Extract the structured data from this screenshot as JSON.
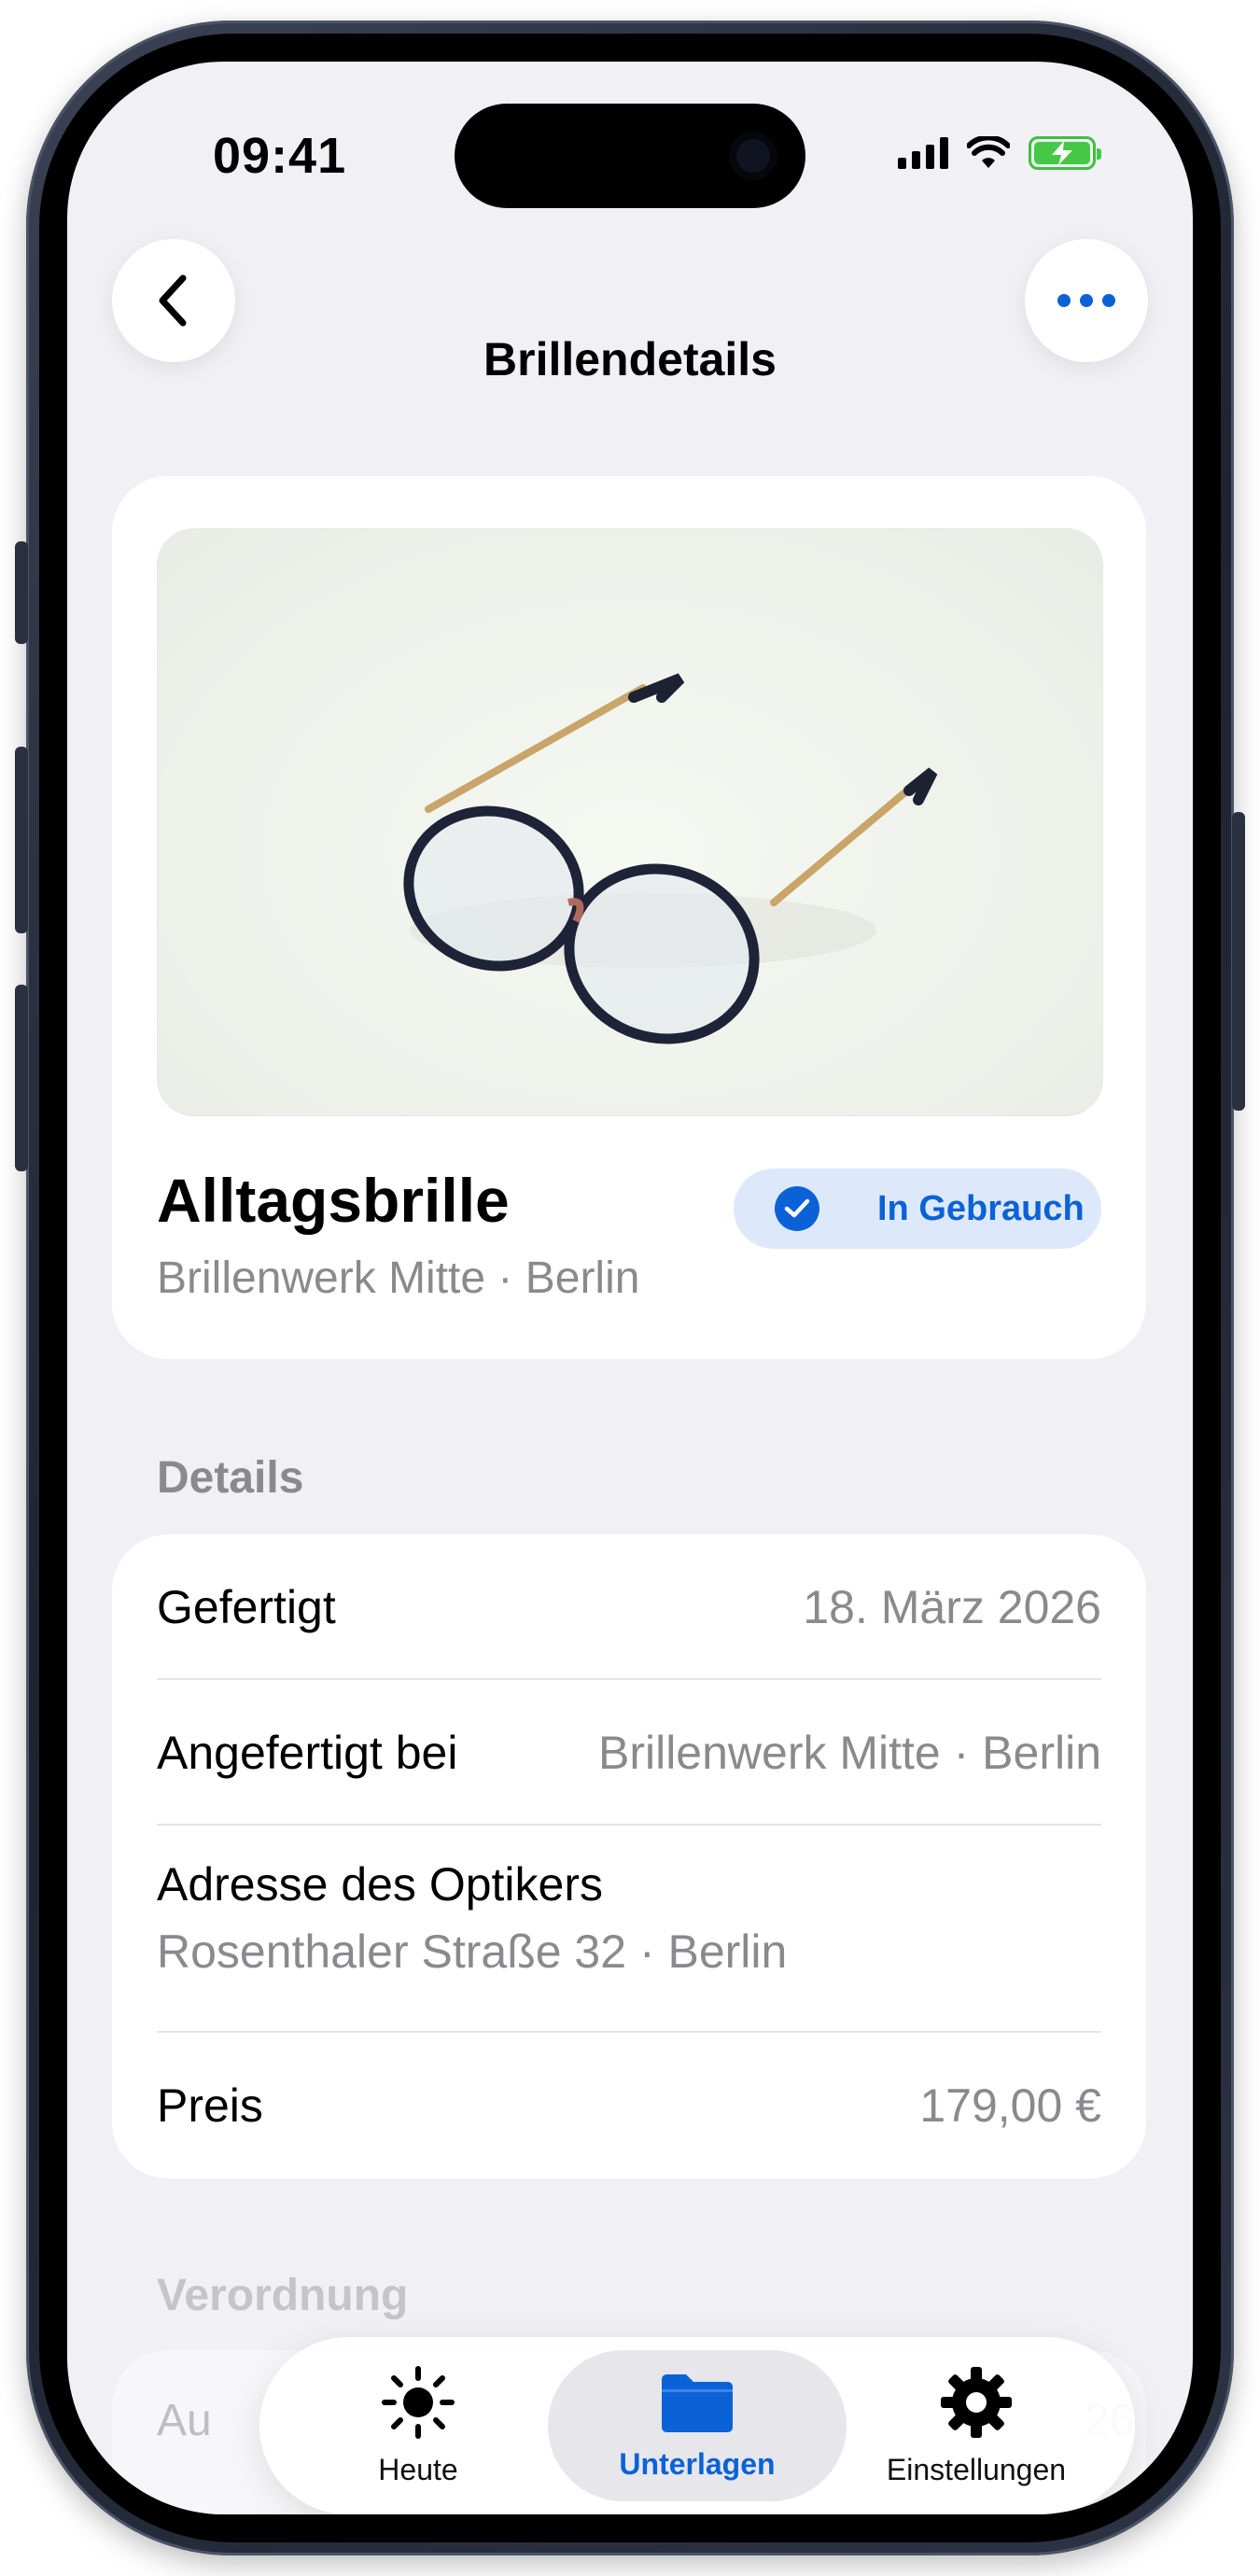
{
  "status_bar": {
    "time": "09:41"
  },
  "header": {
    "title": "Brillendetails"
  },
  "glasses": {
    "name": "Alltagsbrille",
    "subtitle": "Brillenwerk Mitte · Berlin",
    "status": "In Gebrauch"
  },
  "details": {
    "section_title": "Details",
    "rows": [
      {
        "label": "Gefertigt",
        "value": "18. März 2026"
      },
      {
        "label": "Angefertigt bei",
        "value": "Brillenwerk Mitte · Berlin"
      },
      {
        "label": "Adresse des Optikers",
        "value": "Rosenthaler Straße 32 · Berlin"
      },
      {
        "label": "Preis",
        "value": "179,00 €"
      }
    ]
  },
  "next_section": {
    "title": "Verordnung",
    "row_label": "Au",
    "row_value": "26"
  },
  "tabbar": {
    "items": [
      {
        "label": "Heute",
        "icon": "sun-icon"
      },
      {
        "label": "Unterlagen",
        "icon": "folder-icon",
        "active": true
      },
      {
        "label": "Einstellungen",
        "icon": "gear-icon"
      }
    ]
  },
  "colors": {
    "accent": "#0b62d6",
    "background": "#f0f0f5",
    "secondary_text": "#8a8a8e"
  }
}
